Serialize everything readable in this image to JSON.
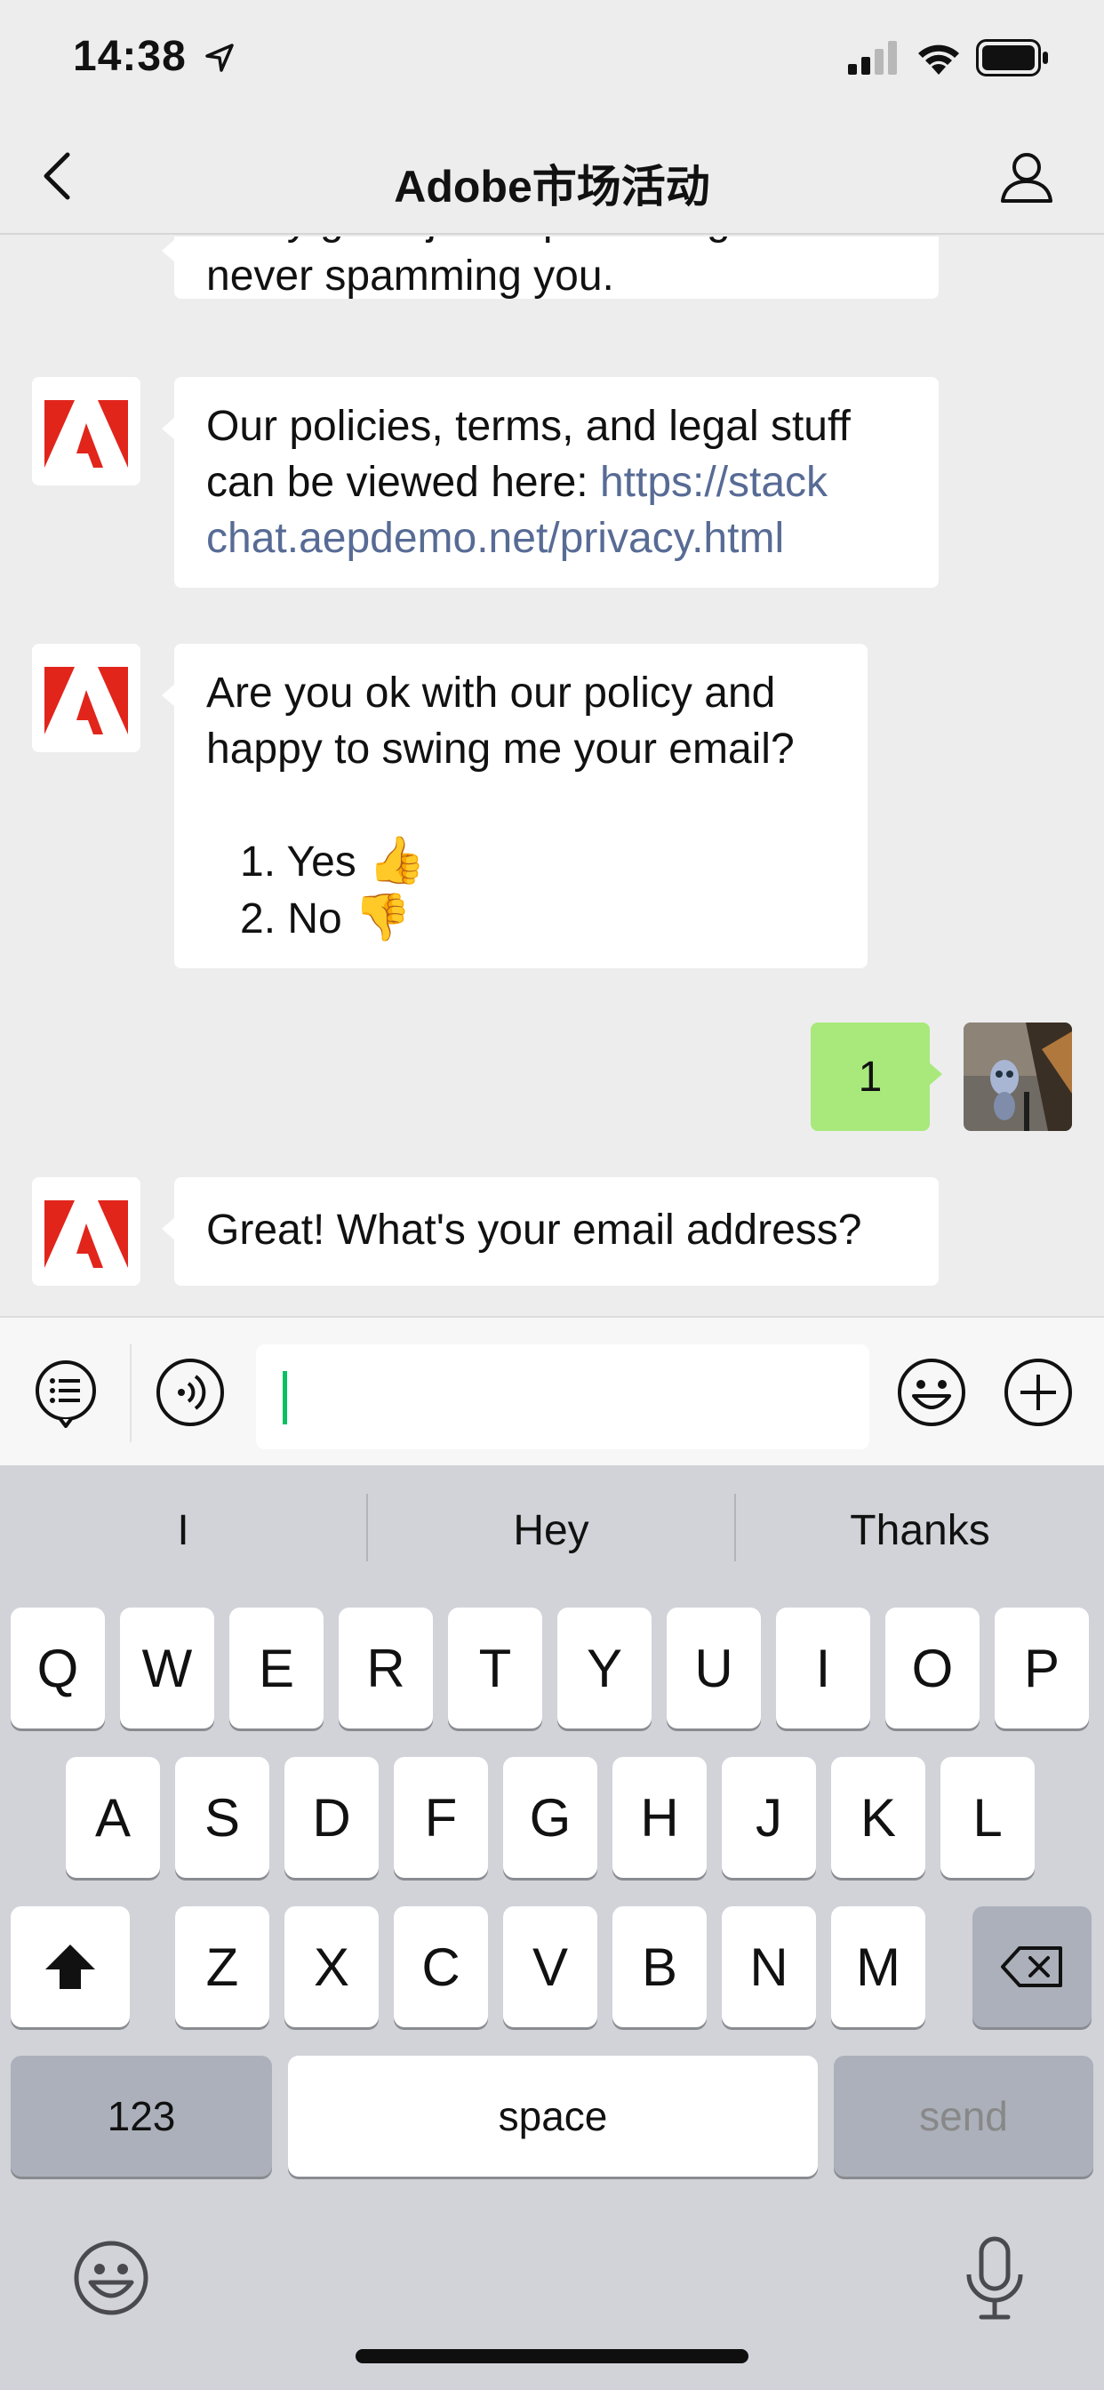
{
  "status_bar": {
    "time": "14:38",
    "icons": [
      "location-arrow-icon",
      "cellular-signal-icon",
      "wifi-icon",
      "battery-icon"
    ]
  },
  "nav": {
    "title": "Adobe市场活动",
    "back_icon": "chevron-left-icon",
    "profile_icon": "person-icon"
  },
  "chat": {
    "messages": [
      {
        "sender": "bot",
        "lines": [
          "really good job of protecting it and",
          "never spamming you."
        ]
      },
      {
        "sender": "bot",
        "line1": "Our policies, terms, and legal stuff",
        "line2_text": "can be viewed here: ",
        "line2_link": "https://stack",
        "line3_link": "chat.aepdemo.net/privacy.html"
      },
      {
        "sender": "bot",
        "lines": [
          "Are you ok with our policy and",
          "happy to swing me your email?"
        ],
        "options": [
          {
            "text": "1. Yes",
            "emoji": "👍"
          },
          {
            "text": "2. No",
            "emoji": "👎"
          }
        ]
      },
      {
        "sender": "user",
        "text": "1"
      },
      {
        "sender": "bot",
        "text": "Great! What's your email address?"
      }
    ]
  },
  "input_bar": {
    "menu_icon": "list-menu-icon",
    "voice_icon": "voice-input-icon",
    "value": "",
    "emoji_icon": "smiley-icon",
    "plus_icon": "plus-circle-icon"
  },
  "keyboard": {
    "suggestions": [
      "I",
      "Hey",
      "Thanks"
    ],
    "row1": [
      "Q",
      "W",
      "E",
      "R",
      "T",
      "Y",
      "U",
      "I",
      "O",
      "P"
    ],
    "row2": [
      "A",
      "S",
      "D",
      "F",
      "G",
      "H",
      "J",
      "K",
      "L"
    ],
    "row3": [
      "Z",
      "X",
      "C",
      "V",
      "B",
      "N",
      "M"
    ],
    "numbers_label": "123",
    "space_label": "space",
    "send_label": "send",
    "shift_icon": "shift-icon",
    "delete_icon": "backspace-icon",
    "emoji_icon": "emoji-keyboard-icon",
    "mic_icon": "microphone-icon"
  },
  "colors": {
    "background": "#ededed",
    "outgoing_bubble": "#a9e97c",
    "link": "#576b95",
    "adobe_red": "#e1251b",
    "cursor": "#07c160"
  }
}
